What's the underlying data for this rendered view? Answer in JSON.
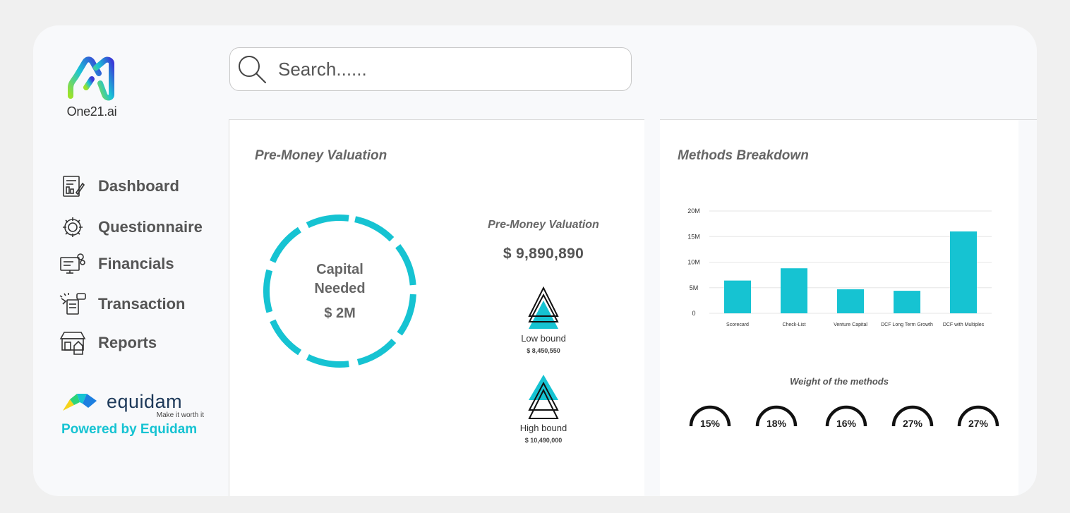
{
  "brand": {
    "name": "One21.ai",
    "display": "One21.ai"
  },
  "colors": {
    "accent": "#16c3d2",
    "text": "#666666",
    "background": "#f8f9fb"
  },
  "sidebar": {
    "items": [
      {
        "label": "Dashboard",
        "icon": "dashboard-icon"
      },
      {
        "label": "Questionnaire",
        "icon": "questionnaire-icon"
      },
      {
        "label": "Financials",
        "icon": "financials-icon"
      },
      {
        "label": "Transaction",
        "icon": "transaction-icon"
      },
      {
        "label": "Reports",
        "icon": "reports-icon"
      }
    ]
  },
  "partner": {
    "name": "equidam",
    "tagline": "Make it worth it",
    "powered": "Powered by Equidam"
  },
  "search": {
    "placeholder": "Search......"
  },
  "valuation": {
    "title": "Pre-Money Valuation",
    "capital_line1": "Capital",
    "capital_line2": "Needed",
    "capital_value": "$ 2M",
    "sub_title": "Pre-Money Valuation",
    "amount": "$  9,890,890",
    "low_label": "Low bound",
    "low_value": "$  8,450,550",
    "high_label": "High bound",
    "high_value": "$  10,490,000"
  },
  "breakdown": {
    "title": "Methods Breakdown",
    "weights_title": "Weight of the methods",
    "weights": [
      {
        "label": "15%",
        "value": 15
      },
      {
        "label": "18%",
        "value": 18
      },
      {
        "label": "16%",
        "value": 16
      },
      {
        "label": "27%",
        "value": 27
      },
      {
        "label": "27%",
        "value": 27
      }
    ]
  },
  "chart_data": {
    "type": "bar",
    "categories": [
      "Scorecard",
      "Check-List",
      "Venture Capital",
      "DCF Long Term Growth",
      "DCF with Multiples"
    ],
    "values": [
      6.4,
      8.8,
      4.7,
      4.4,
      16.0
    ],
    "y_tick_labels": [
      "0",
      "5M",
      "10M",
      "15M",
      "20M"
    ],
    "y_ticks": [
      0,
      5,
      10,
      15,
      20
    ],
    "ylim": [
      0,
      20
    ],
    "grid": true,
    "bar_color": "#16c3d2"
  }
}
